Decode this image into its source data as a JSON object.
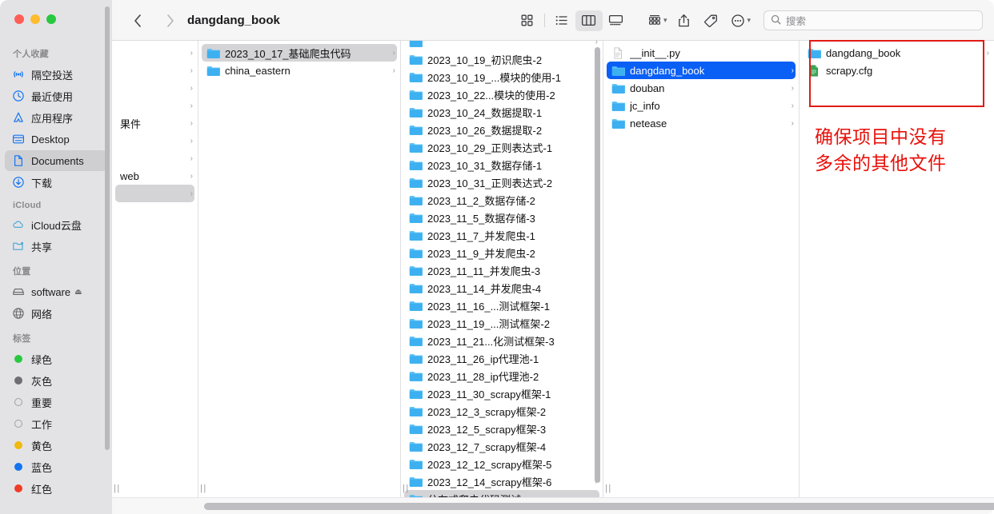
{
  "window": {
    "title": "dangdang_book",
    "traffic_lights": [
      "close-red",
      "minimize-yellow",
      "maximize-green"
    ]
  },
  "toolbar": {
    "back_icon": "chevron-left-icon",
    "forward_icon": "chevron-right-icon",
    "title": "dangdang_book",
    "view_icons": [
      "icon-view",
      "list-view",
      "column-view",
      "gallery-view"
    ],
    "active_view": "column-view",
    "group_icon": "group-by-icon",
    "share_icon": "share-icon",
    "tag_icon": "tag-icon",
    "more_icon": "more-ellipsis-icon",
    "search": {
      "placeholder": "搜索",
      "value": "",
      "icon": "search-icon"
    }
  },
  "sidebar": {
    "groups": [
      {
        "title": "个人收藏",
        "items": [
          {
            "label": "隔空投送",
            "icon": "airdrop-icon",
            "selected": false
          },
          {
            "label": "最近使用",
            "icon": "clock-icon",
            "selected": false
          },
          {
            "label": "应用程序",
            "icon": "applications-icon",
            "selected": false
          },
          {
            "label": "Desktop",
            "icon": "desktop-icon",
            "selected": false
          },
          {
            "label": "Documents",
            "icon": "document-icon",
            "selected": true
          },
          {
            "label": "下载",
            "icon": "download-icon",
            "selected": false
          }
        ]
      },
      {
        "title": "iCloud",
        "items": [
          {
            "label": "iCloud云盘",
            "icon": "cloud-icon",
            "selected": false
          },
          {
            "label": "共享",
            "icon": "shared-folder-icon",
            "selected": false
          }
        ]
      },
      {
        "title": "位置",
        "items": [
          {
            "label": "software",
            "icon": "disk-icon",
            "selected": false,
            "eject": true
          },
          {
            "label": "网络",
            "icon": "network-icon",
            "selected": false
          }
        ]
      },
      {
        "title": "标签",
        "items": [
          {
            "label": "绿色",
            "icon": "tag-dot-icon",
            "color": "#28c840",
            "selected": false
          },
          {
            "label": "灰色",
            "icon": "tag-dot-icon",
            "color": "#6e6e73",
            "selected": false
          },
          {
            "label": "重要",
            "icon": "tag-dot-icon",
            "color": "hollow",
            "selected": false
          },
          {
            "label": "工作",
            "icon": "tag-dot-icon",
            "color": "hollow",
            "selected": false
          },
          {
            "label": "黄色",
            "icon": "tag-dot-icon",
            "color": "#efb90f",
            "selected": false
          },
          {
            "label": "蓝色",
            "icon": "tag-dot-icon",
            "color": "#1474f0",
            "selected": false
          },
          {
            "label": "红色",
            "icon": "tag-dot-icon",
            "color": "#f03b26",
            "selected": false
          }
        ]
      }
    ]
  },
  "columns": [
    {
      "name": "column-0",
      "items": [
        {
          "label": "",
          "icon": "none",
          "arrow": true,
          "selected": false
        },
        {
          "label": "",
          "icon": "none",
          "arrow": true,
          "selected": false
        },
        {
          "label": "",
          "icon": "none",
          "arrow": true,
          "selected": false
        },
        {
          "label": "",
          "icon": "none",
          "arrow": true,
          "selected": false
        },
        {
          "label": "果件",
          "icon": "none",
          "arrow": true,
          "selected": false
        },
        {
          "label": "",
          "icon": "none",
          "arrow": true,
          "selected": false
        },
        {
          "label": "",
          "icon": "none",
          "arrow": true,
          "selected": false
        },
        {
          "label": "web",
          "icon": "none",
          "arrow": true,
          "selected": false
        },
        {
          "label": "",
          "icon": "none",
          "arrow": true,
          "selected": true
        }
      ]
    },
    {
      "name": "column-1",
      "items": [
        {
          "label": "2023_10_17_基础爬虫代码",
          "icon": "folder-icon",
          "arrow": true,
          "selected": true
        },
        {
          "label": "china_eastern",
          "icon": "folder-icon",
          "arrow": true,
          "selected": false
        }
      ]
    },
    {
      "name": "column-2",
      "scroll": true,
      "items": [
        {
          "label": "",
          "icon": "folder-icon",
          "arrow": true,
          "selected": false,
          "clipped": true
        },
        {
          "label": "2023_10_19_初识爬虫-2",
          "icon": "folder-icon",
          "arrow": true,
          "selected": false
        },
        {
          "label": "2023_10_19_...模块的使用-1",
          "icon": "folder-icon",
          "arrow": true,
          "selected": false
        },
        {
          "label": "2023_10_22...模块的使用-2",
          "icon": "folder-icon",
          "arrow": true,
          "selected": false
        },
        {
          "label": "2023_10_24_数据提取-1",
          "icon": "folder-icon",
          "arrow": true,
          "selected": false
        },
        {
          "label": "2023_10_26_数据提取-2",
          "icon": "folder-icon",
          "arrow": true,
          "selected": false
        },
        {
          "label": "2023_10_29_正则表达式-1",
          "icon": "folder-icon",
          "arrow": true,
          "selected": false
        },
        {
          "label": "2023_10_31_数据存储-1",
          "icon": "folder-icon",
          "arrow": true,
          "selected": false
        },
        {
          "label": "2023_10_31_正则表达式-2",
          "icon": "folder-icon",
          "arrow": true,
          "selected": false
        },
        {
          "label": "2023_11_2_数据存储-2",
          "icon": "folder-icon",
          "arrow": true,
          "selected": false
        },
        {
          "label": "2023_11_5_数据存储-3",
          "icon": "folder-icon",
          "arrow": true,
          "selected": false
        },
        {
          "label": "2023_11_7_并发爬虫-1",
          "icon": "folder-icon",
          "arrow": true,
          "selected": false
        },
        {
          "label": "2023_11_9_并发爬虫-2",
          "icon": "folder-icon",
          "arrow": true,
          "selected": false
        },
        {
          "label": "2023_11_11_并发爬虫-3",
          "icon": "folder-icon",
          "arrow": true,
          "selected": false
        },
        {
          "label": "2023_11_14_并发爬虫-4",
          "icon": "folder-icon",
          "arrow": true,
          "selected": false
        },
        {
          "label": "2023_11_16_...测试框架-1",
          "icon": "folder-icon",
          "arrow": true,
          "selected": false
        },
        {
          "label": "2023_11_19_...测试框架-2",
          "icon": "folder-icon",
          "arrow": true,
          "selected": false
        },
        {
          "label": "2023_11_21...化测试框架-3",
          "icon": "folder-icon",
          "arrow": true,
          "selected": false
        },
        {
          "label": "2023_11_26_ip代理池-1",
          "icon": "folder-icon",
          "arrow": true,
          "selected": false
        },
        {
          "label": "2023_11_28_ip代理池-2",
          "icon": "folder-icon",
          "arrow": true,
          "selected": false
        },
        {
          "label": "2023_11_30_scrapy框架-1",
          "icon": "folder-icon",
          "arrow": true,
          "selected": false
        },
        {
          "label": "2023_12_3_scrapy框架-2",
          "icon": "folder-icon",
          "arrow": true,
          "selected": false
        },
        {
          "label": "2023_12_5_scrapy框架-3",
          "icon": "folder-icon",
          "arrow": true,
          "selected": false
        },
        {
          "label": "2023_12_7_scrapy框架-4",
          "icon": "folder-icon",
          "arrow": true,
          "selected": false
        },
        {
          "label": "2023_12_12_scrapy框架-5",
          "icon": "folder-icon",
          "arrow": true,
          "selected": false
        },
        {
          "label": "2023_12_14_scrapy框架-6",
          "icon": "folder-icon",
          "arrow": true,
          "selected": false
        },
        {
          "label": "分布式爬虫代码测试",
          "icon": "folder-icon",
          "arrow": true,
          "selected": true,
          "gray": true
        }
      ]
    },
    {
      "name": "column-3",
      "items": [
        {
          "label": "__init__.py",
          "icon": "python-file-icon",
          "arrow": false,
          "selected": false
        },
        {
          "label": "dangdang_book",
          "icon": "folder-icon",
          "arrow": true,
          "selected": true,
          "blue": true
        },
        {
          "label": "douban",
          "icon": "folder-icon",
          "arrow": true,
          "selected": false
        },
        {
          "label": "jc_info",
          "icon": "folder-icon",
          "arrow": true,
          "selected": false
        },
        {
          "label": "netease",
          "icon": "folder-icon",
          "arrow": true,
          "selected": false
        }
      ]
    },
    {
      "name": "column-4",
      "items": [
        {
          "label": "dangdang_book",
          "icon": "folder-icon",
          "arrow": true,
          "selected": false
        },
        {
          "label": "scrapy.cfg",
          "icon": "cfg-file-icon",
          "arrow": false,
          "selected": false
        }
      ]
    }
  ],
  "annotation": {
    "box_color": "#e01b14",
    "text_color": "#e8110a",
    "lines": [
      "确保项目中没有",
      "多余的其他文件"
    ],
    "text": "确保项目中没有多余的其他文件"
  }
}
